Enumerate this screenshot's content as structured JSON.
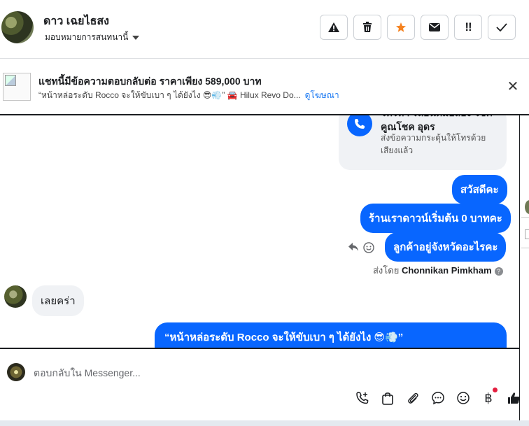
{
  "header": {
    "contact_name": "ดาว เฉยไธสง",
    "assign_label": "มอบหมายการสนทนานี้",
    "buttons": [
      {
        "name": "spam-warning",
        "glyph": "!"
      },
      {
        "name": "delete",
        "glyph": "🗑"
      },
      {
        "name": "star",
        "glyph": "★"
      },
      {
        "name": "mark-unread",
        "glyph": "✉"
      },
      {
        "name": "follow-up",
        "glyph": "!!"
      },
      {
        "name": "done",
        "glyph": "✓"
      }
    ]
  },
  "ad": {
    "title": "แชทนี้มีข้อความตอบกลับต่อ ราคาเพียง 589,000 บาท",
    "subtitle": "“หน้าหล่อระดับ Rocco จะให้ขับเบา ๆ ได้ยังไง 😎💨” 🚘 Hilux Revo Do...",
    "link": "ดูโฆษณา"
  },
  "chat": {
    "call_card": {
      "title": "โทรหา รถยนต์มือสอง โชคคูณโชค อุดร",
      "desc": "ส่งข้อความกระตุ้นให้โทรด้วยเสียงแล้ว"
    },
    "messages_out": [
      "สวัสดีคะ",
      "ร้านเราดาวน์เริ่มต้น 0 บาทคะ",
      "ลูกค้าอยู่จังหวัดอะไรคะ"
    ],
    "sent_by_prefix": "ส่งโดย",
    "sent_by_name": "Chonnikan Pimkham",
    "message_in": "เลยคร่า",
    "big_message_line": "“หน้าหล่อระดับ Rocco จะให้ขับเบา ๆ ได้ยังไง 😎💨”"
  },
  "composer": {
    "placeholder": "ตอบกลับใน Messenger...",
    "tools": [
      "call-icon",
      "bag-icon",
      "attach-icon",
      "chat-bubble-icon",
      "emoji-icon",
      "baht-icon",
      "thumbs-up-icon"
    ]
  },
  "colors": {
    "accent": "#0866ff",
    "incoming_bg": "#f0f2f5",
    "star": "#f5821f",
    "notification_dot": "#e41e3f"
  }
}
